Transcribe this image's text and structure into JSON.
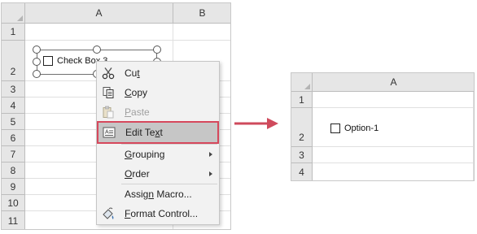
{
  "left_sheet": {
    "columns": [
      "A",
      "B"
    ],
    "rows": [
      "1",
      "2",
      "3",
      "4",
      "5",
      "6",
      "7",
      "8",
      "9",
      "10",
      "11"
    ],
    "checkbox_label": "Check Box 3"
  },
  "context_menu": {
    "items": [
      {
        "label_pre": "Cu",
        "label_u": "t",
        "label_post": "",
        "icon": "scissors-icon",
        "disabled": false
      },
      {
        "label_pre": "",
        "label_u": "C",
        "label_post": "opy",
        "icon": "copy-icon",
        "disabled": false
      },
      {
        "label_pre": "",
        "label_u": "P",
        "label_post": "aste",
        "icon": "paste-icon",
        "disabled": true
      },
      {
        "label_pre": "Edit Te",
        "label_u": "x",
        "label_post": "t",
        "icon": "edit-text-icon",
        "disabled": false,
        "highlighted": true
      },
      {
        "label_pre": "",
        "label_u": "G",
        "label_post": "rouping",
        "submenu": true
      },
      {
        "label_pre": "",
        "label_u": "O",
        "label_post": "rder",
        "submenu": true
      },
      {
        "label_pre": "Assig",
        "label_u": "n",
        "label_post": " Macro...",
        "disabled": false
      },
      {
        "label_pre": "",
        "label_u": "F",
        "label_post": "ormat Control...",
        "icon": "format-control-icon",
        "disabled": false
      }
    ]
  },
  "right_sheet": {
    "columns": [
      "A"
    ],
    "rows": [
      "1",
      "2",
      "3",
      "4"
    ],
    "checkbox_label": "Option-1"
  },
  "colors": {
    "highlight_border": "#d6485c",
    "arrow": "#cf4a5c"
  }
}
